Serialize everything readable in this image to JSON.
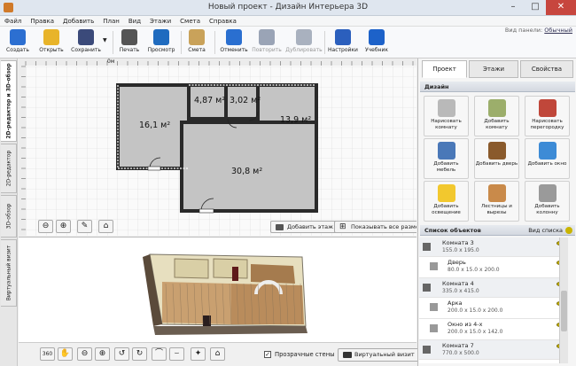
{
  "window": {
    "title": "Новый проект - Дизайн Интерьера 3D"
  },
  "menu": [
    "Файл",
    "Правка",
    "Добавить",
    "План",
    "Вид",
    "Этажи",
    "Смета",
    "Справка"
  ],
  "toolbar": {
    "items": [
      {
        "label": "Создать",
        "icon": "new-file-icon",
        "color": "#2c6fd1",
        "enabled": true
      },
      {
        "label": "Открыть",
        "icon": "open-folder-icon",
        "color": "#e8b42a",
        "enabled": true
      },
      {
        "label": "Сохранить",
        "icon": "save-disk-icon",
        "color": "#3b4a7a",
        "enabled": true
      },
      {
        "label": "Печать",
        "icon": "printer-icon",
        "color": "#555555",
        "enabled": true
      },
      {
        "label": "Просмотр",
        "icon": "monitor-icon",
        "color": "#1f6bbf",
        "enabled": true
      },
      {
        "label": "Смета",
        "icon": "estimate-icon",
        "color": "#c9a25a",
        "enabled": true
      },
      {
        "label": "Отменить",
        "icon": "undo-icon",
        "color": "#2a6fd0",
        "enabled": true
      },
      {
        "label": "Повторить",
        "icon": "redo-icon",
        "color": "#9aa4b6",
        "enabled": false
      },
      {
        "label": "Дублировать",
        "icon": "duplicate-icon",
        "color": "#a9b1bf",
        "enabled": false
      },
      {
        "label": "Настройки",
        "icon": "gear-icon",
        "color": "#2b5fbd",
        "enabled": true
      },
      {
        "label": "Учебник",
        "icon": "help-icon",
        "color": "#1d62c9",
        "enabled": true
      }
    ],
    "view_panel_label": "Вид панели:",
    "view_panel_value": "Обычный"
  },
  "side_tabs": [
    "2D-редактор и 3D-обзор",
    "2D-редактор",
    "3D-обзор",
    "Виртуальный визит"
  ],
  "plan": {
    "ruler_origin": "0м",
    "rooms": [
      {
        "label": "16,1 м²"
      },
      {
        "label": "4,87 м²"
      },
      {
        "label": "3,02 м²"
      },
      {
        "label": "13,9 м²"
      },
      {
        "label": "30,8 м²"
      }
    ],
    "add_floor": "Добавить этаж",
    "show_dims": "Показывать все размеры"
  },
  "bottom": {
    "transparent_walls": "Прозрачные стены",
    "virtual_visit": "Виртуальный визит"
  },
  "right_panel": {
    "tabs": [
      "Проект",
      "Этажи",
      "Свойства"
    ],
    "design_title": "Дизайн",
    "design_buttons": [
      {
        "label": "Нарисовать комнату",
        "icon": "draw-room-icon",
        "color": "#b9b9b9"
      },
      {
        "label": "Добавить комнату",
        "icon": "add-room-icon",
        "color": "#9cae6b"
      },
      {
        "label": "Нарисовать перегородку",
        "icon": "brick-wall-icon",
        "color": "#c0473a"
      },
      {
        "label": "Добавить мебель",
        "icon": "furniture-icon",
        "color": "#4a78b8"
      },
      {
        "label": "Добавить дверь",
        "icon": "door-icon",
        "color": "#8a5a2c"
      },
      {
        "label": "Добавить окно",
        "icon": "window-icon",
        "color": "#3d8bd6"
      },
      {
        "label": "Добавить освещение",
        "icon": "lightbulb-icon",
        "color": "#f2c82e"
      },
      {
        "label": "Лестницы и вырезы",
        "icon": "stairs-icon",
        "color": "#c98a4a"
      },
      {
        "label": "Добавить колонну",
        "icon": "column-icon",
        "color": "#9a9a9a"
      }
    ],
    "objects_title": "Список объектов",
    "objects_view": "Вид списка",
    "objects": [
      {
        "name": "Комната 3",
        "dims": "155.0 x 195.0",
        "group": true
      },
      {
        "name": "Дверь",
        "dims": "80.0 x 15.0 x 200.0",
        "group": false
      },
      {
        "name": "Комната 4",
        "dims": "335.0 x 415.0",
        "group": true
      },
      {
        "name": "Арка",
        "dims": "200.0 x 15.0 x 200.0",
        "group": false
      },
      {
        "name": "Окно из 4-х",
        "dims": "200.0 x 15.0 x 142.0",
        "group": false
      },
      {
        "name": "Комната 7",
        "dims": "770.0 x 500.0",
        "group": true
      }
    ]
  }
}
